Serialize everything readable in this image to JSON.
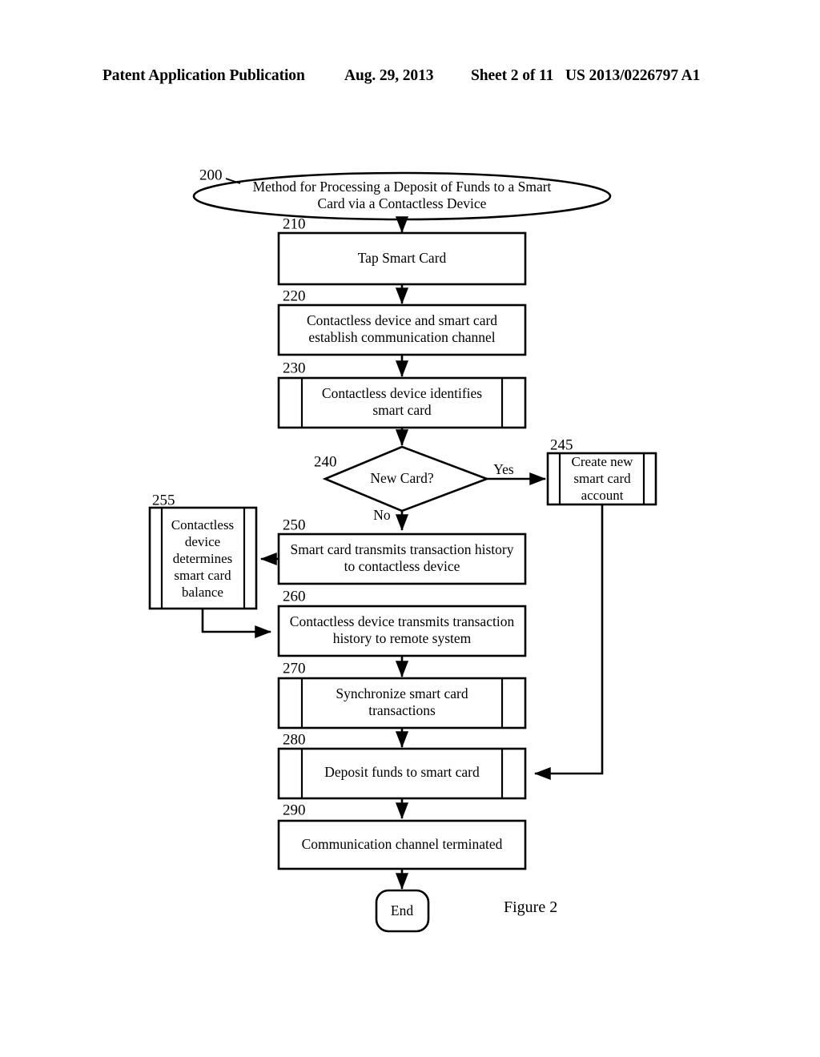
{
  "header": {
    "publication": "Patent Application Publication",
    "date": "Aug. 29, 2013",
    "sheet": "Sheet 2 of 11",
    "patent_number": "US 2013/0226797 A1"
  },
  "figure": {
    "caption": "Figure 2",
    "title_ref": "200",
    "title": "Method for Processing a Deposit of Funds to a Smart Card via a Contactless Device",
    "title_line1": "Method for Processing a Deposit of Funds to a Smart",
    "title_line2": "Card via a Contactless Device"
  },
  "nodes": {
    "n210": {
      "ref": "210",
      "shape": "process",
      "line1": "Tap Smart Card",
      "line2": ""
    },
    "n220": {
      "ref": "220",
      "shape": "process",
      "line1": "Contactless device and smart card",
      "line2": "establish communication channel"
    },
    "n230": {
      "ref": "230",
      "shape": "predefined-process",
      "line1": "Contactless device identifies",
      "line2": "smart card"
    },
    "n240": {
      "ref": "240",
      "shape": "decision",
      "line1": "New Card?",
      "line2": ""
    },
    "n245": {
      "ref": "245",
      "shape": "predefined-process",
      "line1": "Create new",
      "line2": "smart card",
      "line3": "account"
    },
    "n250": {
      "ref": "250",
      "shape": "process",
      "line1": "Smart card transmits transaction history",
      "line2": "to contactless device"
    },
    "n255": {
      "ref": "255",
      "shape": "predefined-process",
      "line1": "Contactless",
      "line2": "device",
      "line3": "determines",
      "line4": "smart card",
      "line5": "balance"
    },
    "n260": {
      "ref": "260",
      "shape": "process",
      "line1": "Contactless device transmits transaction",
      "line2": "history to remote system"
    },
    "n270": {
      "ref": "270",
      "shape": "predefined-process",
      "line1": "Synchronize smart card",
      "line2": "transactions"
    },
    "n280": {
      "ref": "280",
      "shape": "predefined-process",
      "line1": "Deposit funds to smart card",
      "line2": ""
    },
    "n290": {
      "ref": "290",
      "shape": "process",
      "line1": "Communication channel terminated",
      "line2": ""
    },
    "nend": {
      "ref": "",
      "shape": "terminator",
      "line1": "End",
      "line2": ""
    }
  },
  "edge_labels": {
    "yes": "Yes",
    "no": "No"
  },
  "colors": {
    "ink": "#000000",
    "paper": "#ffffff"
  }
}
